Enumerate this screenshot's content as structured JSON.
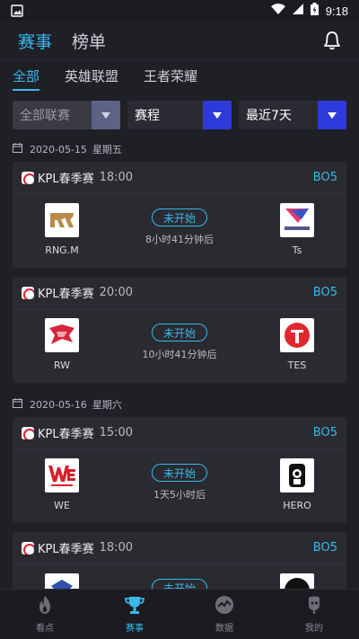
{
  "status": {
    "time": "9:18"
  },
  "top_tabs": [
    {
      "label": "赛事"
    },
    {
      "label": "榜单"
    }
  ],
  "sub_tabs": [
    {
      "label": "全部"
    },
    {
      "label": "英雄联盟"
    },
    {
      "label": "王者荣耀"
    }
  ],
  "filters": {
    "league": "全部联赛",
    "type": "赛程",
    "range": "最近7天"
  },
  "groups": [
    {
      "date": "2020-05-15",
      "weekday": "星期五",
      "matches": [
        {
          "league": "KPL春季赛",
          "time": "18:00",
          "bo": "BO5",
          "status": "未开始",
          "countdown": "8小时41分钟后",
          "home": "RNG.M",
          "away": "Ts"
        },
        {
          "league": "KPL春季赛",
          "time": "20:00",
          "bo": "BO5",
          "status": "未开始",
          "countdown": "10小时41分钟后",
          "home": "RW",
          "away": "TES"
        }
      ]
    },
    {
      "date": "2020-05-16",
      "weekday": "星期六",
      "matches": [
        {
          "league": "KPL春季赛",
          "time": "15:00",
          "bo": "BO5",
          "status": "未开始",
          "countdown": "1天5小时后",
          "home": "WE",
          "away": "HERO"
        },
        {
          "league": "KPL春季赛",
          "time": "18:00",
          "bo": "BO5",
          "status": "未开始",
          "countdown": "",
          "home": "",
          "away": ""
        }
      ]
    }
  ],
  "bottom_tabs": [
    {
      "label": "看点"
    },
    {
      "label": "赛事"
    },
    {
      "label": "数据"
    },
    {
      "label": "我的"
    }
  ],
  "colors": {
    "accent": "#39b9ea",
    "dropdown": "#2e3ad9",
    "background": "#1f1f26",
    "card": "#2a2a31"
  }
}
